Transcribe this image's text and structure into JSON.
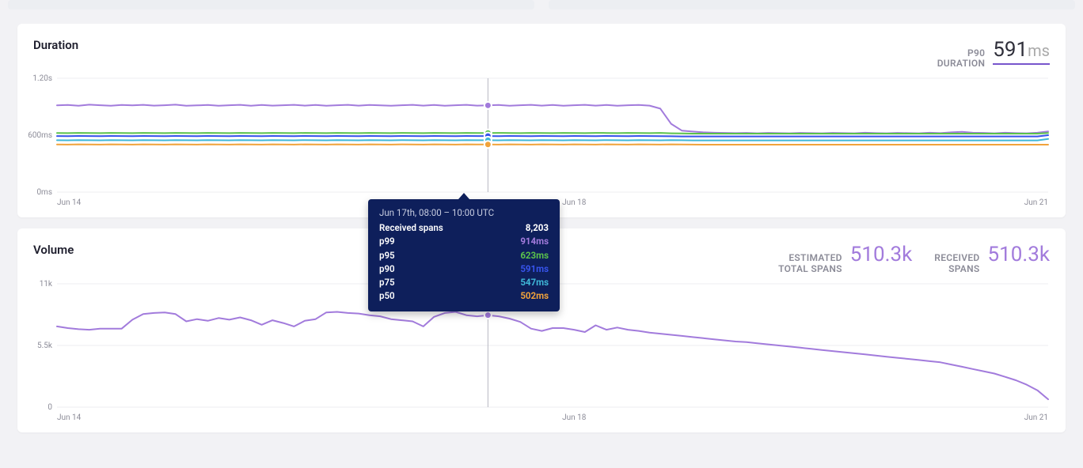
{
  "panels": {
    "duration": {
      "title": "Duration",
      "stats": [
        {
          "label_top": "P90",
          "label_bottom": "DURATION",
          "value": "591",
          "unit": "ms",
          "underline": true,
          "purple": false
        }
      ]
    },
    "volume": {
      "title": "Volume",
      "stats": [
        {
          "label_top": "ESTIMATED",
          "label_bottom": "TOTAL SPANS",
          "value": "510.3k",
          "unit": "",
          "underline": false,
          "purple": true
        },
        {
          "label_top": "RECEIVED",
          "label_bottom": "SPANS",
          "value": "510.3k",
          "unit": "",
          "underline": false,
          "purple": true
        }
      ]
    }
  },
  "tooltip": {
    "title": "Jun 17th, 08:00 – 10:00 UTC",
    "rows": [
      {
        "label": "Received spans",
        "value": "8,203",
        "color": "#ffffff"
      },
      {
        "label": "p99",
        "value": "914ms",
        "color": "#a27bdc"
      },
      {
        "label": "p95",
        "value": "623ms",
        "color": "#5bc24b"
      },
      {
        "label": "p90",
        "value": "591ms",
        "color": "#3754ec"
      },
      {
        "label": "p75",
        "value": "547ms",
        "color": "#3fb7d8"
      },
      {
        "label": "p50",
        "value": "502ms",
        "color": "#f1a33b"
      }
    ]
  },
  "chart_data": [
    {
      "id": "duration",
      "type": "line",
      "title": "Duration",
      "xlabel": "",
      "ylabel": "",
      "ylim": [
        0,
        1200
      ],
      "yticks": [
        {
          "v": 0,
          "label": "0ms"
        },
        {
          "v": 600,
          "label": "600ms"
        },
        {
          "v": 1200,
          "label": "1.20s"
        }
      ],
      "x": [
        "Jun 14",
        "",
        "",
        "",
        "",
        "",
        "",
        "",
        "",
        "",
        "",
        "",
        "",
        "",
        "",
        "",
        "",
        "",
        "",
        "",
        "",
        "",
        "",
        "",
        "",
        "",
        "",
        "",
        "",
        "",
        "",
        "",
        "",
        "",
        "",
        "",
        "",
        "",
        "",
        "",
        "",
        "",
        "",
        "",
        "",
        "",
        "",
        "",
        "Jun 18",
        "",
        "",
        "",
        "",
        "",
        "",
        "",
        "",
        "",
        "",
        "",
        "",
        "",
        "",
        "",
        "",
        "",
        "",
        "",
        "",
        "",
        "",
        "",
        "",
        "",
        "",
        "",
        "",
        "",
        "",
        "",
        "",
        "",
        "",
        "",
        "",
        "",
        "",
        "",
        "",
        "",
        "",
        "",
        "Jun 21"
      ],
      "xticks": [
        {
          "i": 0,
          "label": "Jun 14"
        },
        {
          "i": 48,
          "label": "Jun 18"
        },
        {
          "i": 92,
          "label": "Jun 21"
        }
      ],
      "hover_index": 40,
      "series": [
        {
          "name": "p99",
          "color": "#a27bdc",
          "values": [
            915,
            918,
            910,
            922,
            916,
            910,
            918,
            914,
            920,
            912,
            916,
            922,
            910,
            914,
            918,
            910,
            916,
            920,
            910,
            918,
            912,
            916,
            920,
            912,
            918,
            910,
            916,
            920,
            912,
            918,
            914,
            910,
            916,
            920,
            912,
            918,
            910,
            916,
            920,
            912,
            914,
            918,
            910,
            916,
            920,
            912,
            918,
            910,
            916,
            920,
            912,
            918,
            910,
            916,
            918,
            912,
            880,
            720,
            648,
            638,
            630,
            626,
            624,
            622,
            624,
            620,
            624,
            622,
            620,
            624,
            622,
            620,
            624,
            622,
            620,
            626,
            622,
            620,
            624,
            622,
            620,
            626,
            622,
            630,
            636,
            626,
            624,
            620,
            626,
            622,
            620,
            626,
            640
          ]
        },
        {
          "name": "p95",
          "color": "#5bc24b",
          "values": [
            623,
            622,
            624,
            623,
            622,
            624,
            623,
            622,
            624,
            623,
            622,
            624,
            623,
            622,
            624,
            623,
            622,
            624,
            623,
            622,
            624,
            623,
            622,
            624,
            623,
            622,
            624,
            623,
            622,
            624,
            623,
            622,
            624,
            623,
            622,
            624,
            623,
            622,
            624,
            623,
            623,
            624,
            623,
            622,
            624,
            623,
            622,
            624,
            623,
            622,
            624,
            623,
            622,
            624,
            623,
            622,
            624,
            620,
            618,
            617,
            617,
            617,
            617,
            617,
            617,
            617,
            617,
            617,
            617,
            617,
            617,
            617,
            617,
            617,
            617,
            617,
            617,
            617,
            617,
            617,
            617,
            617,
            617,
            617,
            617,
            617,
            617,
            617,
            617,
            617,
            617,
            617,
            623
          ]
        },
        {
          "name": "p90",
          "color": "#3754ec",
          "values": [
            591,
            590,
            592,
            591,
            590,
            592,
            591,
            590,
            592,
            591,
            590,
            592,
            591,
            590,
            592,
            591,
            590,
            592,
            591,
            590,
            592,
            591,
            590,
            592,
            591,
            590,
            592,
            591,
            590,
            592,
            591,
            590,
            592,
            591,
            590,
            592,
            591,
            590,
            592,
            591,
            591,
            590,
            592,
            591,
            590,
            592,
            591,
            590,
            592,
            591,
            590,
            592,
            591,
            590,
            592,
            591,
            590,
            588,
            587,
            587,
            587,
            587,
            587,
            587,
            587,
            587,
            587,
            587,
            587,
            587,
            587,
            587,
            587,
            587,
            587,
            587,
            587,
            587,
            587,
            587,
            587,
            587,
            587,
            587,
            587,
            587,
            587,
            587,
            587,
            587,
            587,
            587,
            600
          ]
        },
        {
          "name": "p75",
          "color": "#3fb7d8",
          "values": [
            547,
            546,
            548,
            547,
            546,
            548,
            547,
            546,
            548,
            547,
            546,
            548,
            547,
            546,
            548,
            547,
            546,
            548,
            547,
            546,
            548,
            547,
            546,
            548,
            547,
            546,
            548,
            547,
            546,
            548,
            547,
            546,
            548,
            547,
            546,
            548,
            547,
            546,
            548,
            547,
            547,
            546,
            548,
            547,
            546,
            548,
            547,
            546,
            548,
            547,
            546,
            548,
            547,
            546,
            548,
            547,
            546,
            548,
            547,
            545,
            545,
            545,
            545,
            545,
            545,
            545,
            545,
            545,
            545,
            545,
            545,
            545,
            545,
            545,
            545,
            545,
            545,
            545,
            545,
            545,
            545,
            545,
            545,
            545,
            545,
            545,
            545,
            545,
            545,
            545,
            545,
            545,
            560
          ]
        },
        {
          "name": "p50",
          "color": "#f1a33b",
          "values": [
            502,
            501,
            503,
            502,
            501,
            503,
            502,
            501,
            503,
            502,
            501,
            503,
            502,
            501,
            503,
            502,
            501,
            503,
            502,
            501,
            503,
            502,
            501,
            503,
            502,
            501,
            503,
            502,
            501,
            503,
            502,
            501,
            503,
            502,
            501,
            503,
            502,
            501,
            503,
            502,
            502,
            501,
            503,
            502,
            501,
            503,
            502,
            501,
            503,
            502,
            501,
            503,
            502,
            501,
            503,
            502,
            501,
            503,
            502,
            501,
            500,
            500,
            500,
            500,
            500,
            500,
            500,
            500,
            500,
            500,
            500,
            500,
            500,
            500,
            500,
            500,
            500,
            500,
            500,
            500,
            500,
            500,
            500,
            500,
            500,
            500,
            500,
            500,
            500,
            500,
            500,
            500,
            500
          ]
        }
      ]
    },
    {
      "id": "volume",
      "type": "line",
      "title": "Volume",
      "xlabel": "",
      "ylabel": "",
      "ylim": [
        0,
        11000
      ],
      "yticks": [
        {
          "v": 0,
          "label": "0"
        },
        {
          "v": 5500,
          "label": "5.5k"
        },
        {
          "v": 11000,
          "label": "11k"
        }
      ],
      "x": [
        "Jun 14",
        "",
        "",
        "",
        "",
        "",
        "",
        "",
        "",
        "",
        "",
        "",
        "",
        "",
        "",
        "",
        "",
        "",
        "",
        "",
        "",
        "",
        "",
        "",
        "",
        "",
        "",
        "",
        "",
        "",
        "",
        "",
        "",
        "",
        "",
        "",
        "",
        "",
        "",
        "",
        "",
        "",
        "",
        "",
        "",
        "",
        "",
        "",
        "Jun 18",
        "",
        "",
        "",
        "",
        "",
        "",
        "",
        "",
        "",
        "",
        "",
        "",
        "",
        "",
        "",
        "",
        "",
        "",
        "",
        "",
        "",
        "",
        "",
        "",
        "",
        "",
        "",
        "",
        "",
        "",
        "",
        "",
        "",
        "",
        "",
        "",
        "",
        "",
        "",
        "",
        "",
        "",
        "",
        "Jun 21"
      ],
      "xticks": [
        {
          "i": 0,
          "label": "Jun 14"
        },
        {
          "i": 48,
          "label": "Jun 18"
        },
        {
          "i": 92,
          "label": "Jun 21"
        }
      ],
      "hover_index": 40,
      "series": [
        {
          "name": "Received spans",
          "color": "#a27bdc",
          "values": [
            7200,
            7050,
            6950,
            6900,
            7000,
            7000,
            7000,
            7800,
            8300,
            8400,
            8450,
            8300,
            7650,
            7850,
            7700,
            7950,
            7800,
            8000,
            7750,
            7350,
            7750,
            7500,
            7200,
            7700,
            7850,
            8450,
            8500,
            8400,
            8350,
            8200,
            8100,
            7850,
            7750,
            7650,
            7200,
            8050,
            8400,
            8500,
            8200,
            8100,
            8203,
            8100,
            7900,
            7600,
            7000,
            6800,
            7050,
            7050,
            6900,
            6700,
            7300,
            6900,
            7100,
            6900,
            6800,
            6650,
            6550,
            6450,
            6350,
            6250,
            6150,
            6050,
            5950,
            5850,
            5800,
            5700,
            5600,
            5500,
            5400,
            5300,
            5200,
            5100,
            5000,
            4900,
            4800,
            4700,
            4600,
            4500,
            4400,
            4300,
            4200,
            4100,
            4000,
            3800,
            3600,
            3400,
            3200,
            3000,
            2700,
            2400,
            2000,
            1500,
            700
          ]
        }
      ]
    }
  ]
}
